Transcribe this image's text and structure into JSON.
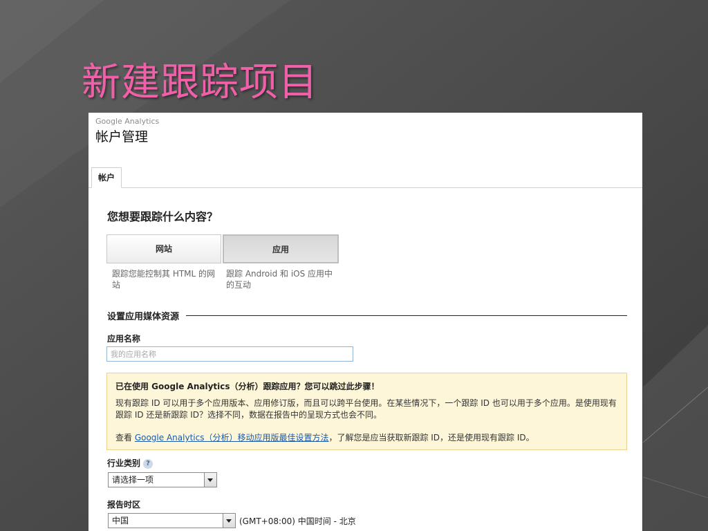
{
  "slide": {
    "title": "新建跟踪项目"
  },
  "header": {
    "brand": "Google Analytics",
    "title": "帐户管理"
  },
  "tabs": [
    {
      "label": "帐户"
    }
  ],
  "question": "您想要跟踪什么内容？",
  "choices": {
    "website": {
      "label": "网站",
      "description": "跟踪您能控制其 HTML 的网站"
    },
    "app": {
      "label": "应用",
      "description": "跟踪 Android 和 iOS 应用中的互动",
      "selected": true
    }
  },
  "section": {
    "title": "设置应用媒体资源"
  },
  "app_name": {
    "label": "应用名称",
    "placeholder": "我的应用名称",
    "value": ""
  },
  "notice": {
    "title": "已在使用 Google Analytics（分析）跟踪应用？您可以跳过此步骤！",
    "body": "现有跟踪 ID 可以用于多个应用版本、应用修订版，而且可以跨平台使用。在某些情况下，一个跟踪 ID 也可以用于多个应用。是使用现有跟踪 ID 还是新跟踪 ID？选择不同，数据在报告中的呈现方式也会不同。",
    "link_prefix": "查看 ",
    "link_text": "Google Analytics（分析）移动应用版最佳设置方法",
    "link_suffix": "，了解您是应当获取新跟踪 ID，还是使用现有跟踪 ID。"
  },
  "industry": {
    "label": "行业类别",
    "help_icon": "?",
    "selected": "请选择一项"
  },
  "timezone": {
    "label": "报告时区",
    "country": "中国",
    "zone": "(GMT+08:00) 中国时间 - 北京"
  },
  "colors": {
    "title_pink": "#f060a8",
    "link_blue": "#1a5aab",
    "notice_bg": "#fdf6d8"
  }
}
